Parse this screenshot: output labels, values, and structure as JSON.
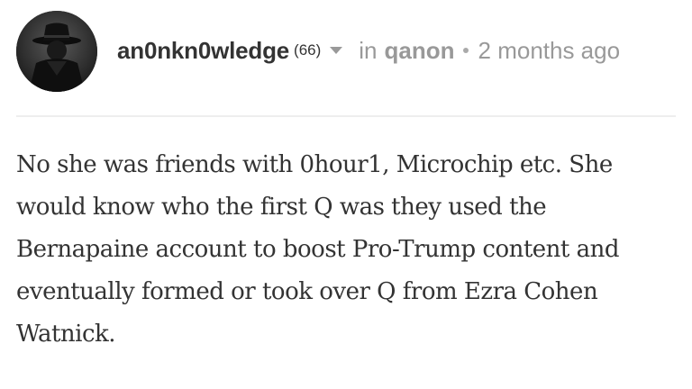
{
  "post": {
    "author": {
      "username": "an0nkn0wledge",
      "reputation": "(66)"
    },
    "in_label": "in",
    "community": "qanon",
    "separator": "•",
    "timestamp": "2 months ago",
    "comment_text": "No she was friends with 0hour1, Microchip etc. She would know who the first Q was they used the Bernapaine account to boost Pro-Trump content and eventually formed or took over Q from Ezra Cohen Watnick."
  },
  "icons": {
    "avatar": "avatar-figure-in-hat",
    "author_menu": "chevron-down-icon"
  }
}
